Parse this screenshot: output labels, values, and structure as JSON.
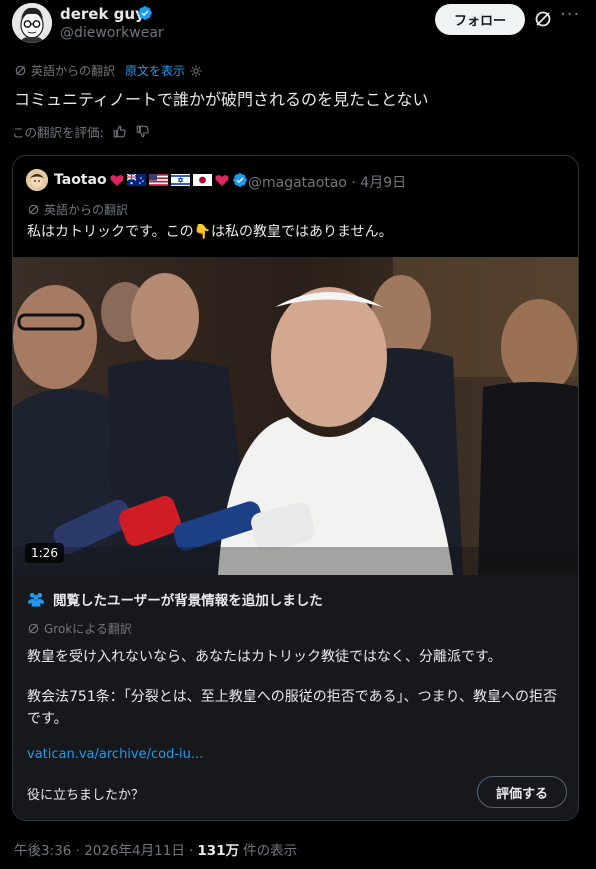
{
  "author": {
    "name": "derek guy",
    "handle": "@dieworkwear"
  },
  "header": {
    "follow_label": "フォロー",
    "more_label": "···"
  },
  "translation": {
    "from_label": "英語からの翻訳",
    "show_original_label": "原文を表示"
  },
  "tweet": {
    "text": "コミュニティノートで誰かが破門されるのを見たことない"
  },
  "rate_translation": {
    "label": "この翻訳を評価:"
  },
  "quote": {
    "name": "Taotao",
    "handle_time": "@magataotao · 4月9日",
    "translation_label": "英語からの翻訳",
    "text_before": "私はカトリックです。この",
    "emoji": "👇",
    "text_after": "は私の教皇ではありません。",
    "video_duration": "1:26"
  },
  "community_note": {
    "title": "閲覧したユーザーが背景情報を追加しました",
    "grok_label": "Grokによる翻訳",
    "paragraph1": "教皇を受け入れないなら、あなたはカトリック教徒ではなく、分離派です。",
    "paragraph2": "教会法751条：「分裂とは、至上教皇への服従の拒否である」、つまり、教皇への拒否です。",
    "link": "vatican.va/archive/cod-iu...",
    "helpful_question": "役に立ちましたか？",
    "rate_button": "評価する"
  },
  "footer": {
    "timestamp": "午後3:36 · 2026年4月11日 ·",
    "views_count": "131万",
    "views_label": "件の表示"
  },
  "colors": {
    "background": "#000000",
    "text": "#e7e9ea",
    "muted": "#71767b",
    "link": "#1d9bf0",
    "verified": "#1d9bf0",
    "card_border": "#2f3336",
    "note_bg": "#16181c"
  },
  "icons": [
    "verified-badge-icon",
    "grok-icon",
    "more-icon",
    "translate-icon",
    "gear-icon",
    "thumbs-up-icon",
    "thumbs-down-icon",
    "people-icon"
  ]
}
